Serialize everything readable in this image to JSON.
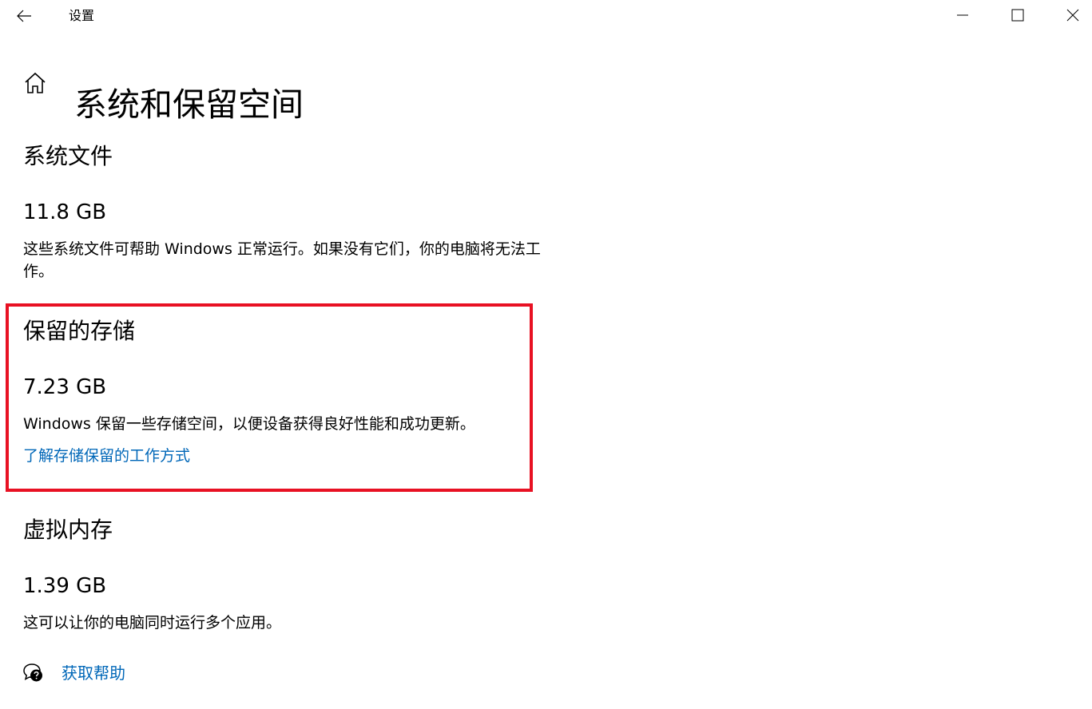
{
  "window": {
    "title": "设置",
    "controls": [
      "minimize-icon",
      "maximize-icon",
      "close-icon"
    ]
  },
  "header": {
    "title": "系统和保留空间",
    "home_icon": "home-icon",
    "back_icon": "arrow-left-icon"
  },
  "sections": [
    {
      "title": "系统文件",
      "size": "11.8 GB",
      "description": "这些系统文件可帮助 Windows 正常运行。如果没有它们，你的电脑将无法工作。"
    },
    {
      "title": "保留的存储",
      "size": "7.23 GB",
      "description": "Windows 保留一些存储空间，以便设备获得良好性能和成功更新。",
      "link": "了解存储保留的工作方式",
      "highlighted": true
    },
    {
      "title": "虚拟内存",
      "size": "1.39 GB",
      "description": "这可以让你的电脑同时运行多个应用。"
    }
  ],
  "help": {
    "label": "获取帮助",
    "icon": "help-chat-icon"
  },
  "colors": {
    "link": "#0067b8",
    "highlight_border": "#e81123",
    "text": "#000000",
    "background": "#ffffff"
  }
}
